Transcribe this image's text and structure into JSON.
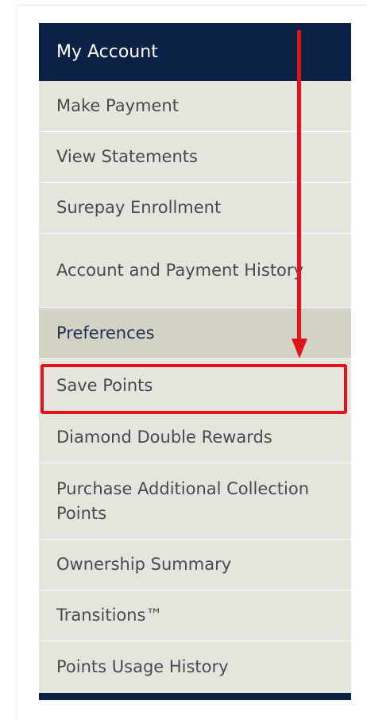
{
  "nav": {
    "title": "My Account",
    "items": [
      {
        "label": "Make Payment",
        "active": false
      },
      {
        "label": "View Statements",
        "active": false
      },
      {
        "label": "Surepay Enrollment",
        "active": false
      },
      {
        "label": "Account and Payment History",
        "active": false
      },
      {
        "label": "Preferences",
        "active": true
      },
      {
        "label": "Save Points",
        "active": false,
        "highlighted": true
      },
      {
        "label": "Diamond Double Rewards",
        "active": false
      },
      {
        "label": "Purchase Additional Collection Points",
        "active": false
      },
      {
        "label": "Ownership Summary",
        "active": false
      },
      {
        "label": "Transitions™",
        "active": false
      },
      {
        "label": "Points Usage History",
        "active": false
      }
    ]
  },
  "annotation": {
    "color": "#e0151b",
    "arrow_icon": "down-arrow-icon",
    "highlight_target": "Save Points"
  },
  "colors": {
    "header_bg": "#0c2146",
    "item_bg": "#e6e5dd",
    "active_bg": "#d3d2c5"
  }
}
